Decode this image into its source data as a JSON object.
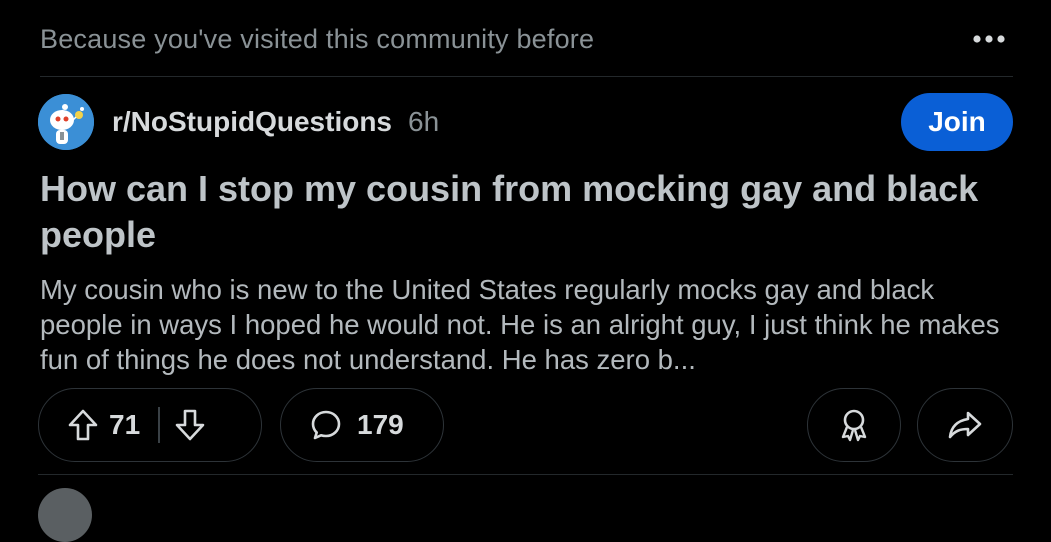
{
  "context": {
    "text": "Because you've visited this community before",
    "more_icon": "more-horizontal-icon"
  },
  "post": {
    "subreddit": "r/NoStupidQuestions",
    "age": "6h",
    "join_label": "Join",
    "title": "How can I stop my cousin from mocking gay and black people",
    "body": "My cousin who is new to the United States regularly mocks gay and black people in ways I hoped he would not. He is an alright guy, I just think he makes fun of things he does not understand. He has zero b...",
    "votes": "71",
    "comments": "179",
    "icons": {
      "upvote": "upvote-arrow-icon",
      "downvote": "downvote-arrow-icon",
      "comment": "comment-bubble-icon",
      "award": "award-icon",
      "share": "share-arrow-icon"
    }
  },
  "colors": {
    "background": "#000000",
    "join_button": "#0a5fd6",
    "avatar": "#3b8fd6",
    "muted_text": "#8a9296",
    "title_text": "#bec4c8"
  }
}
